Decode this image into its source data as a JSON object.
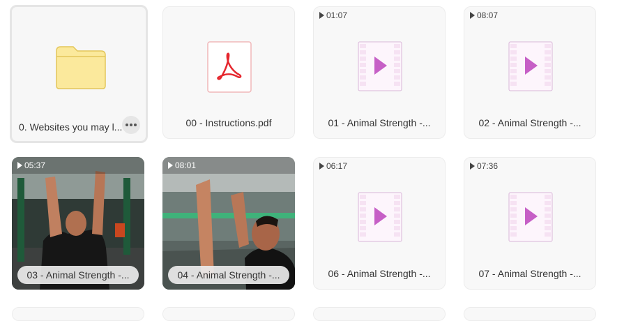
{
  "files": [
    {
      "name": "0. Websites you may l...",
      "kind": "folder"
    },
    {
      "name": "00 - Instructions.pdf",
      "kind": "pdf"
    },
    {
      "name": "01 - Animal Strength -...",
      "kind": "video",
      "duration": "01:07"
    },
    {
      "name": "02 - Animal Strength -...",
      "kind": "video",
      "duration": "08:07"
    },
    {
      "name": "03 - Animal Strength -...",
      "kind": "video-thumb",
      "duration": "05:37"
    },
    {
      "name": "04 - Animal Strength -...",
      "kind": "video-thumb",
      "duration": "08:01"
    },
    {
      "name": "06 - Animal Strength -...",
      "kind": "video",
      "duration": "06:17"
    },
    {
      "name": "07 - Animal Strength -...",
      "kind": "video",
      "duration": "07:36"
    }
  ],
  "icons": {
    "folder": "folder-icon",
    "pdf": "pdf-icon",
    "video": "video-file-icon",
    "play": "play-icon",
    "more": "more-options-icon"
  },
  "colors": {
    "folder_fill": "#fbe99c",
    "folder_stroke": "#e3c65a",
    "pdf_red": "#e5262d",
    "video_purple": "#c65fc6",
    "video_light": "#f6e2f3"
  }
}
